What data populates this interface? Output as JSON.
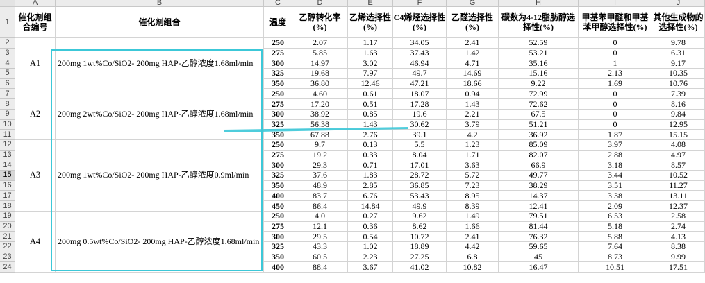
{
  "column_letters": [
    "A",
    "B",
    "C",
    "D",
    "E",
    "F",
    "G",
    "H",
    "I",
    "J"
  ],
  "header_row": {
    "row_num": "1",
    "cells": [
      "催化剂组合编号",
      "催化剂组合",
      "温度",
      "乙醇转化率(%)",
      "乙烯选择性(%)",
      "C4烯烃选择性(%)",
      "乙醛选择性(%)",
      "碳数为4-12脂肪醇选择性(%)",
      "甲基苯甲醛和甲基苯甲醇选择性(%)",
      "其他生成物的选择性(%)"
    ]
  },
  "groups": [
    {
      "id": "A1",
      "catalyst": "200mg 1wt%Co/SiO2- 200mg HAP-乙醇浓度1.68ml/min",
      "rows": [
        {
          "r": "2",
          "v": [
            "250",
            "2.07",
            "1.17",
            "34.05",
            "2.41",
            "52.59",
            "0",
            "9.78"
          ]
        },
        {
          "r": "3",
          "v": [
            "275",
            "5.85",
            "1.63",
            "37.43",
            "1.42",
            "53.21",
            "0",
            "6.31"
          ]
        },
        {
          "r": "4",
          "v": [
            "300",
            "14.97",
            "3.02",
            "46.94",
            "4.71",
            "35.16",
            "1",
            "9.17"
          ]
        },
        {
          "r": "5",
          "v": [
            "325",
            "19.68",
            "7.97",
            "49.7",
            "14.69",
            "15.16",
            "2.13",
            "10.35"
          ]
        },
        {
          "r": "6",
          "v": [
            "350",
            "36.80",
            "12.46",
            "47.21",
            "18.66",
            "9.22",
            "1.69",
            "10.76"
          ]
        }
      ]
    },
    {
      "id": "A2",
      "catalyst": "200mg 2wt%Co/SiO2- 200mg HAP-乙醇浓度1.68ml/min",
      "rows": [
        {
          "r": "7",
          "v": [
            "250",
            "4.60",
            "0.61",
            "18.07",
            "0.94",
            "72.99",
            "0",
            "7.39"
          ]
        },
        {
          "r": "8",
          "v": [
            "275",
            "17.20",
            "0.51",
            "17.28",
            "1.43",
            "72.62",
            "0",
            "8.16"
          ]
        },
        {
          "r": "9",
          "v": [
            "300",
            "38.92",
            "0.85",
            "19.6",
            "2.21",
            "67.5",
            "0",
            "9.84"
          ]
        },
        {
          "r": "10",
          "v": [
            "325",
            "56.38",
            "1.43",
            "30.62",
            "3.79",
            "51.21",
            "0",
            "12.95"
          ]
        },
        {
          "r": "11",
          "v": [
            "350",
            "67.88",
            "2.76",
            "39.1",
            "4.2",
            "36.92",
            "1.87",
            "15.15"
          ]
        }
      ]
    },
    {
      "id": "A3",
      "catalyst": "200mg 1wt%Co/SiO2- 200mg HAP-乙醇浓度0.9ml/min",
      "rows": [
        {
          "r": "12",
          "v": [
            "250",
            "9.7",
            "0.13",
            "5.5",
            "1.23",
            "85.09",
            "3.97",
            "4.08"
          ]
        },
        {
          "r": "13",
          "v": [
            "275",
            "19.2",
            "0.33",
            "8.04",
            "1.71",
            "82.07",
            "2.88",
            "4.97"
          ]
        },
        {
          "r": "14",
          "v": [
            "300",
            "29.3",
            "0.71",
            "17.01",
            "3.63",
            "66.9",
            "3.18",
            "8.57"
          ]
        },
        {
          "r": "15",
          "v": [
            "325",
            "37.6",
            "1.83",
            "28.72",
            "5.72",
            "49.77",
            "3.44",
            "10.52"
          ]
        },
        {
          "r": "16",
          "v": [
            "350",
            "48.9",
            "2.85",
            "36.85",
            "7.23",
            "38.29",
            "3.51",
            "11.27"
          ]
        },
        {
          "r": "17",
          "v": [
            "400",
            "83.7",
            "6.76",
            "53.43",
            "8.95",
            "14.37",
            "3.38",
            "13.11"
          ]
        },
        {
          "r": "18",
          "v": [
            "450",
            "86.4",
            "14.84",
            "49.9",
            "8.39",
            "12.41",
            "2.09",
            "12.37"
          ]
        }
      ]
    },
    {
      "id": "A4",
      "catalyst": "200mg 0.5wt%Co/SiO2- 200mg HAP-乙醇浓度1.68ml/min",
      "rows": [
        {
          "r": "19",
          "v": [
            "250",
            "4.0",
            "0.27",
            "9.62",
            "1.49",
            "79.51",
            "6.53",
            "2.58"
          ]
        },
        {
          "r": "20",
          "v": [
            "275",
            "12.1",
            "0.36",
            "8.62",
            "1.66",
            "81.44",
            "5.18",
            "2.74"
          ]
        },
        {
          "r": "21",
          "v": [
            "300",
            "29.5",
            "0.54",
            "10.72",
            "2.41",
            "76.32",
            "5.88",
            "4.13"
          ]
        },
        {
          "r": "22",
          "v": [
            "325",
            "43.3",
            "1.02",
            "18.89",
            "4.42",
            "59.65",
            "7.64",
            "8.38"
          ]
        },
        {
          "r": "23",
          "v": [
            "350",
            "60.5",
            "2.23",
            "27.25",
            "6.8",
            "45",
            "8.73",
            "9.99"
          ]
        },
        {
          "r": "24",
          "v": [
            "400",
            "88.4",
            "3.67",
            "41.02",
            "10.82",
            "16.47",
            "10.51",
            "17.51"
          ]
        }
      ]
    }
  ],
  "active_row": "15",
  "colors": {
    "highlight_box": "#3cc8d8",
    "header_bg": "#ececec",
    "grid": "#d4d4d4"
  }
}
